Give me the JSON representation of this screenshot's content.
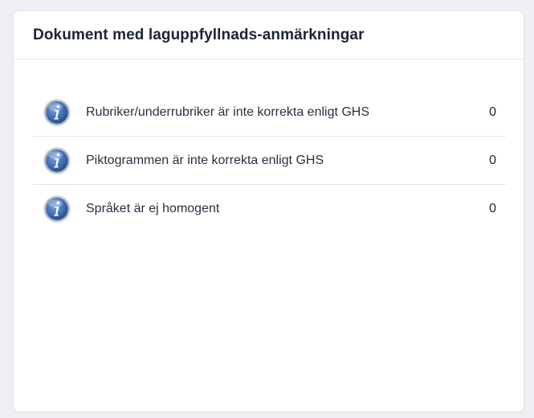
{
  "card": {
    "title": "Dokument med laguppfyllnads-anmärkningar"
  },
  "items": [
    {
      "icon": "info-icon",
      "label": "Rubriker/underrubriker är inte korrekta enligt GHS",
      "count": "0"
    },
    {
      "icon": "info-icon",
      "label": "Piktogrammen är inte korrekta enligt GHS",
      "count": "0"
    },
    {
      "icon": "info-icon",
      "label": "Språket är ej homogent",
      "count": "0"
    }
  ],
  "colors": {
    "icon_blue": "#3d6fb5",
    "icon_ring": "#c7ccd4",
    "background": "#eef0f4"
  }
}
